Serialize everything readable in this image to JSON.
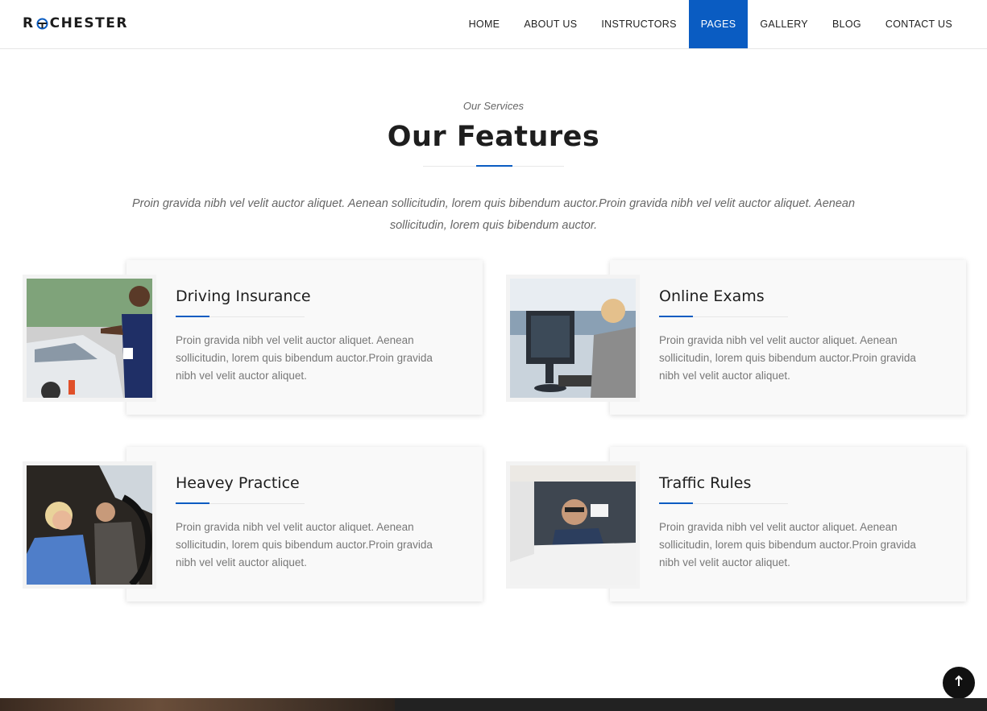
{
  "header": {
    "logo_prefix": "R",
    "logo_suffix": "CHESTER",
    "nav": [
      {
        "label": "HOME"
      },
      {
        "label": "ABOUT US"
      },
      {
        "label": "INSTRUCTORS"
      },
      {
        "label": "PAGES"
      },
      {
        "label": "GALLERY"
      },
      {
        "label": "BLOG"
      },
      {
        "label": "CONTACT US"
      }
    ],
    "active_nav": "PAGES"
  },
  "section": {
    "eyebrow": "Our Services",
    "title": "Our Features",
    "intro": "Proin gravida nibh vel velit auctor aliquet. Aenean sollicitudin, lorem quis bibendum auctor.Proin gravida nibh vel velit auctor aliquet. Aenean sollicitudin, lorem quis bibendum auctor."
  },
  "features": [
    {
      "title": "Driving Insurance",
      "text": "Proin gravida nibh vel velit auctor aliquet. Aenean sollicitudin, lorem quis bibendum auctor.Proin gravida nibh vel velit auctor aliquet.",
      "image": "instructor-beside-car-photo"
    },
    {
      "title": "Online Exams",
      "text": "Proin gravida nibh vel velit auctor aliquet. Aenean sollicitudin, lorem quis bibendum auctor.Proin gravida nibh vel velit auctor aliquet.",
      "image": "woman-at-computer-photo"
    },
    {
      "title": "Heavey Practice",
      "text": "Proin gravida nibh vel velit auctor aliquet. Aenean sollicitudin, lorem quis bibendum auctor.Proin gravida nibh vel velit auctor aliquet.",
      "image": "student-driving-with-instructor-photo"
    },
    {
      "title": "Traffic Rules",
      "text": "Proin gravida nibh vel velit auctor aliquet. Aenean sollicitudin, lorem quis bibendum auctor.Proin gravida nibh vel velit auctor aliquet.",
      "image": "man-showing-license-in-car-photo"
    }
  ],
  "icons": {
    "back_to_top": "arrow-up-icon"
  },
  "colors": {
    "accent": "#0a5cc2",
    "dark": "#111111"
  }
}
